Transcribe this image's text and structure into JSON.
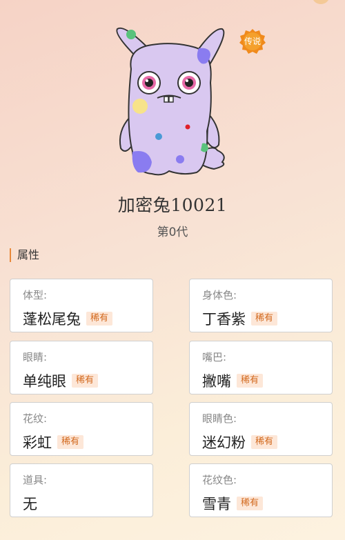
{
  "rarity_badge": "传说",
  "pet": {
    "name": "加密兔10021",
    "generation": "第0代"
  },
  "section_title": "属性",
  "attributes": [
    {
      "label": "体型:",
      "value": "蓬松尾兔",
      "rarity": "稀有"
    },
    {
      "label": "身体色:",
      "value": "丁香紫",
      "rarity": "稀有"
    },
    {
      "label": "眼睛:",
      "value": "单纯眼",
      "rarity": "稀有"
    },
    {
      "label": "嘴巴:",
      "value": "撇嘴",
      "rarity": "稀有"
    },
    {
      "label": "花纹:",
      "value": "彩虹",
      "rarity": "稀有"
    },
    {
      "label": "眼睛色:",
      "value": "迷幻粉",
      "rarity": "稀有"
    },
    {
      "label": "道具:",
      "value": "无"
    },
    {
      "label": "花纹色:",
      "value": "雪青",
      "rarity": "稀有"
    }
  ],
  "colors": {
    "accent": "#e8883a",
    "body": "#d9c8f0",
    "badge": "#f08a1c",
    "rarity_bg": "#fde7d8",
    "rarity_text": "#d2691e"
  }
}
